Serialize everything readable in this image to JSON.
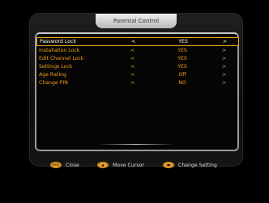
{
  "title": "Parental Control",
  "menu": {
    "items": [
      {
        "label": "Password Lock",
        "value": "YES",
        "left_arrow": "<",
        "right_arrow": ">"
      },
      {
        "label": "Installation Lock",
        "value": "YES",
        "left_arrow": "<",
        "right_arrow": ">"
      },
      {
        "label": "Edit Channel Lock",
        "value": "YES",
        "left_arrow": "<",
        "right_arrow": ">"
      },
      {
        "label": "Settings Lock",
        "value": "YES",
        "left_arrow": "<",
        "right_arrow": ">"
      },
      {
        "label": "Age Rating",
        "value": "Off",
        "left_arrow": "<",
        "right_arrow": ">"
      },
      {
        "label": "Change PIN",
        "value": "NO",
        "left_arrow": "<",
        "right_arrow": ">"
      }
    ],
    "selected_index": 0
  },
  "legend": {
    "close": {
      "key": "exit",
      "label": "Close"
    },
    "move_cursor": {
      "key": "ud-arrows-icon",
      "label": "Move Cursor"
    },
    "change_setting": {
      "key": "lr-arrows-icon",
      "label": "Change Setting"
    }
  },
  "colors": {
    "accent": "#f2a51c",
    "text_selected": "#ffffff",
    "background": "#000000"
  }
}
